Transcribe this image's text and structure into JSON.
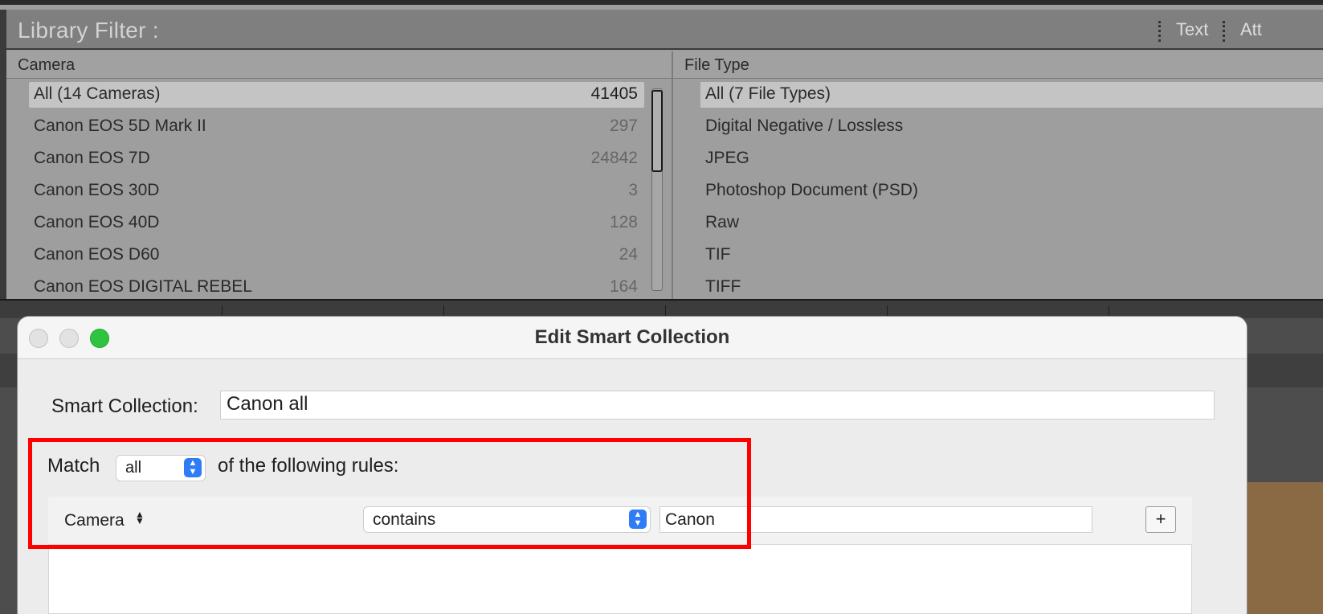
{
  "library_filter": {
    "title": "Library Filter :",
    "tabs": [
      "Text",
      "Att"
    ]
  },
  "camera_column": {
    "header": "Camera",
    "rows": [
      {
        "name": "All (14 Cameras)",
        "count": "41405",
        "selected": true
      },
      {
        "name": "Canon EOS 5D Mark II",
        "count": "297"
      },
      {
        "name": "Canon EOS 7D",
        "count": "24842"
      },
      {
        "name": "Canon EOS 30D",
        "count": "3"
      },
      {
        "name": "Canon EOS 40D",
        "count": "128"
      },
      {
        "name": "Canon EOS D60",
        "count": "24"
      },
      {
        "name": "Canon EOS DIGITAL REBEL",
        "count": "164"
      }
    ]
  },
  "filetype_column": {
    "header": "File Type",
    "rows": [
      {
        "name": "All (7 File Types)",
        "selected": true
      },
      {
        "name": "Digital Negative / Lossless"
      },
      {
        "name": "JPEG"
      },
      {
        "name": "Photoshop Document (PSD)"
      },
      {
        "name": "Raw"
      },
      {
        "name": "TIF"
      },
      {
        "name": "TIFF"
      }
    ]
  },
  "dialog": {
    "title": "Edit Smart Collection",
    "name_label": "Smart Collection:",
    "name_value": "Canon all",
    "match_label": "Match",
    "match_value": "all",
    "match_suffix": "of the following rules:",
    "rule": {
      "field": "Camera",
      "operator": "contains",
      "value": "Canon",
      "add_label": "+"
    }
  },
  "colors": {
    "highlight": "#ff0000",
    "accent": "#2f7df6",
    "zoom_button": "#2ec440"
  }
}
